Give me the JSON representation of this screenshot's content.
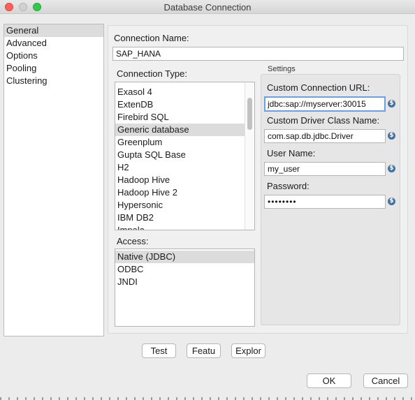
{
  "window": {
    "title": "Database Connection"
  },
  "sidebar": {
    "items": [
      {
        "label": "General"
      },
      {
        "label": "Advanced"
      },
      {
        "label": "Options"
      },
      {
        "label": "Pooling"
      },
      {
        "label": "Clustering"
      }
    ]
  },
  "connection_name": {
    "label": "Connection Name:",
    "value": "SAP_HANA"
  },
  "connection_type": {
    "label": "Connection Type:",
    "items": [
      "Exasol 4",
      "ExtenDB",
      "Firebird SQL",
      "Generic database",
      "Greenplum",
      "Gupta SQL Base",
      "H2",
      "Hadoop Hive",
      "Hadoop Hive 2",
      "Hypersonic",
      "IBM DB2",
      "Impala"
    ],
    "selected": "Generic database"
  },
  "access": {
    "label": "Access:",
    "items": [
      "Native (JDBC)",
      "ODBC",
      "JNDI"
    ],
    "selected": "Native (JDBC)"
  },
  "settings": {
    "caption": "Settings",
    "url_label": "Custom Connection URL:",
    "url_value": "jdbc:sap://myserver:30015",
    "driver_label": "Custom Driver Class Name:",
    "driver_value": "com.sap.db.jdbc.Driver",
    "user_label": "User Name:",
    "user_value": "my_user",
    "password_label": "Password:",
    "password_value": "••••••••",
    "variable_icon": "$"
  },
  "buttons": {
    "test": "Test",
    "features": "Featu",
    "explore": "Explor",
    "ok": "OK",
    "cancel": "Cancel"
  }
}
